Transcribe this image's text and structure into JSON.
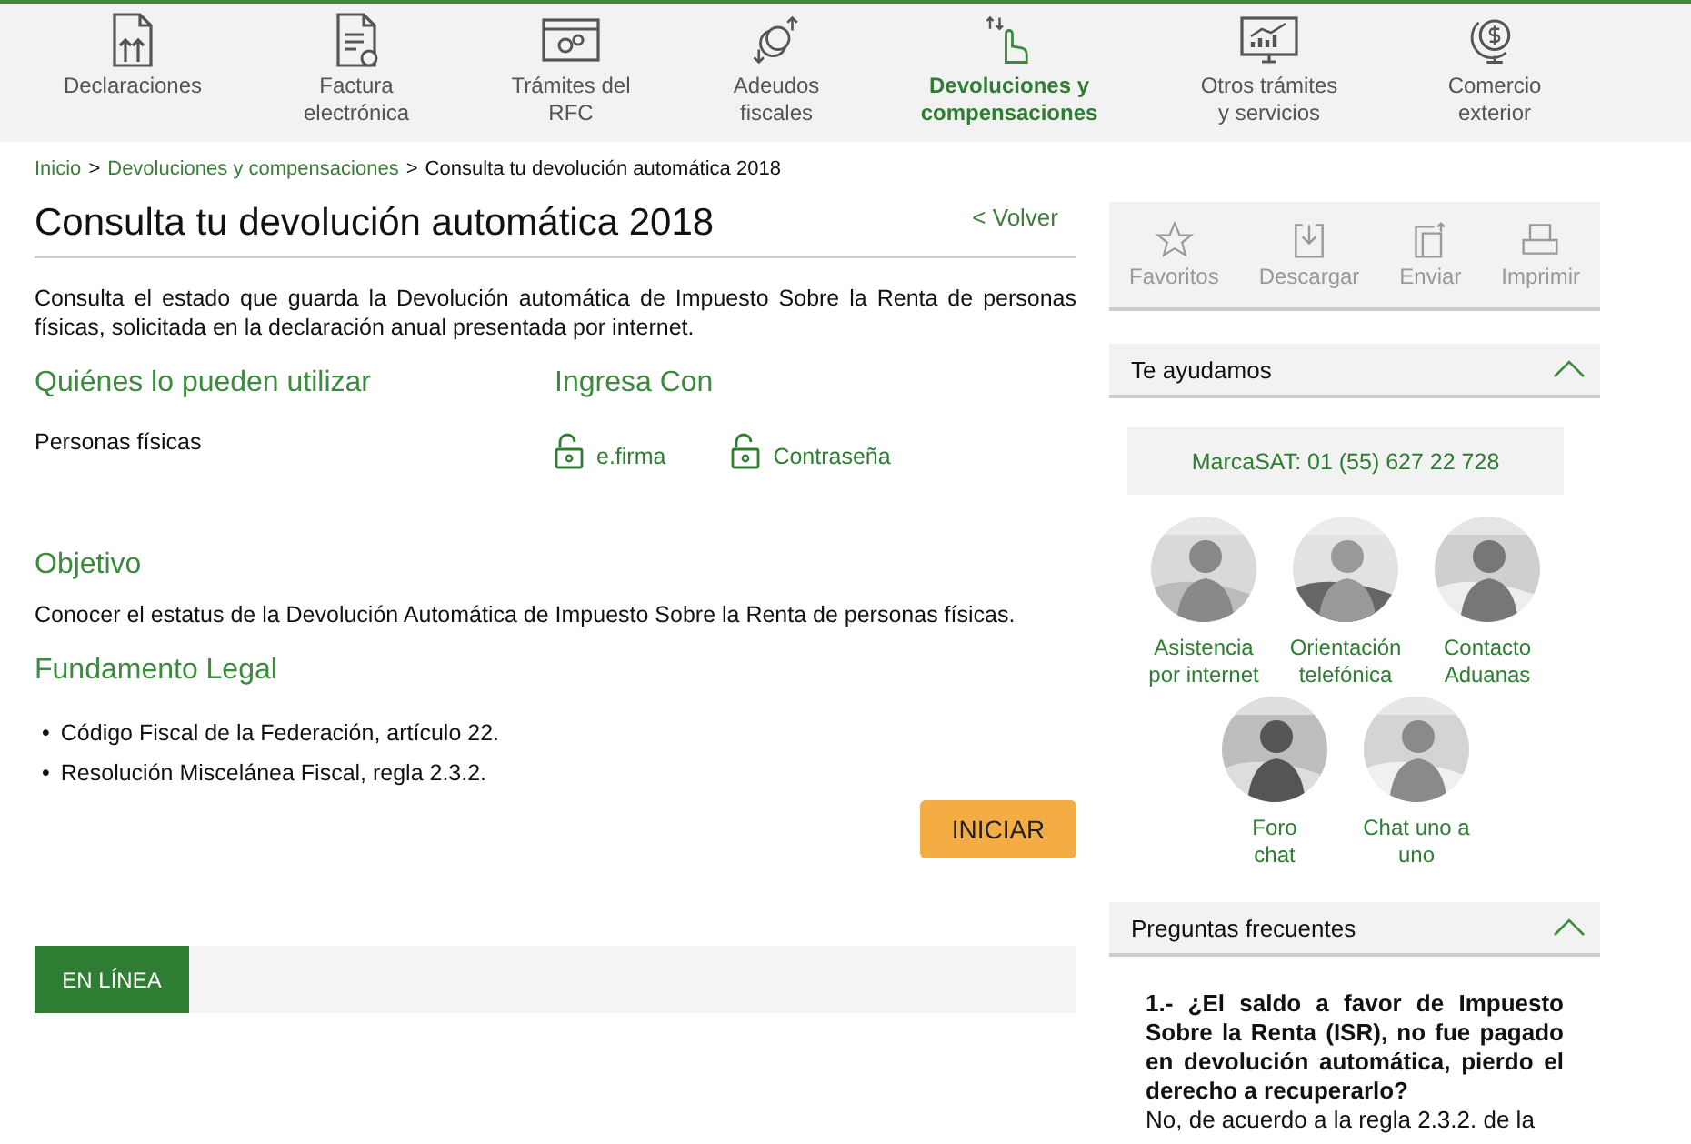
{
  "nav": [
    {
      "label": "Declaraciones",
      "selected": false
    },
    {
      "label": "Factura\nelectrónica",
      "selected": false
    },
    {
      "label": "Trámites del\nRFC",
      "selected": false
    },
    {
      "label": "Adeudos\nfiscales",
      "selected": false
    },
    {
      "label": "Devoluciones y\ncompensaciones",
      "selected": true
    },
    {
      "label": "Otros trámites\ny servicios",
      "selected": false
    },
    {
      "label": "Comercio\nexterior",
      "selected": false
    }
  ],
  "breadcrumb": {
    "links": [
      "Inicio",
      "Devoluciones y compensaciones"
    ],
    "separator": ">",
    "current": "Consulta tu devolución automática 2018"
  },
  "title": "Consulta tu devolución automática 2018",
  "back_link": "< Volver",
  "intro": "Consulta el estado que guarda la Devolución automática de Impuesto Sobre la Renta de personas físicas, solicitada en la declaración anual presentada por internet.",
  "who": {
    "heading": "Quiénes lo pueden utilizar",
    "text": "Personas físicas"
  },
  "login": {
    "heading": "Ingresa Con",
    "options": [
      "e.firma",
      "Contraseña"
    ]
  },
  "objective": {
    "heading": "Objetivo",
    "text": "Conocer el estatus de la Devolución Automática de Impuesto Sobre la Renta de personas físicas."
  },
  "legal": {
    "heading": "Fundamento Legal",
    "bullet": "•",
    "items": [
      "Código Fiscal de la Federación, artículo 22.",
      "Resolución Miscelánea Fiscal, regla 2.3.2."
    ]
  },
  "start_button": "INICIAR",
  "online_tab": "EN LÍNEA",
  "tools": [
    "Favoritos",
    "Descargar",
    "Enviar",
    "Imprimir"
  ],
  "help": {
    "title": "Te ayudamos",
    "expanded": true,
    "phone": "MarcaSAT: 01 (55) 627 22 728",
    "channels": [
      {
        "label": "Asistencia\npor internet",
        "kind": "picture"
      },
      {
        "label": "Orientación\ntelefónica",
        "kind": "picture"
      },
      {
        "label": "Contacto\nAduanas",
        "kind": "picture"
      },
      {
        "label": "Foro\nchat",
        "kind": "picture"
      },
      {
        "label": "Chat uno a\nuno",
        "kind": "picture"
      }
    ]
  },
  "faq": {
    "title": "Preguntas frecuentes",
    "expanded": true,
    "question": "1.- ¿El saldo a favor de Impuesto Sobre la Renta (ISR), no fue pagado en devolución automática, pierdo el derecho a recuperarlo?",
    "answer": "No, de acuerdo a la regla 2.3.2. de la"
  }
}
